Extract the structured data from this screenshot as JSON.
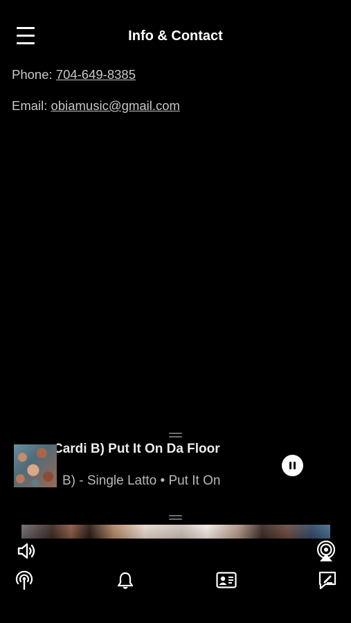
{
  "header": {
    "title": "Info & Contact",
    "menu_icon": "hamburger-menu-icon"
  },
  "contact": {
    "phone_label": "Phone:",
    "phone_value": "704-649-8385",
    "email_label": "Email:",
    "email_value": "obiamusic@gmail.com"
  },
  "now_playing": {
    "title_marquee": "Cardi B) Put It On Da Floor",
    "subtitle_marquee": "B) - Single Latto • Put It On",
    "state": "playing",
    "pause_icon": "pause-icon"
  },
  "video_controls": {
    "volume_icon": "speaker-volume-icon",
    "airplay_icon": "airplay-icon"
  },
  "tab_bar": {
    "items": [
      {
        "icon": "podcast-broadcast-icon"
      },
      {
        "icon": "bell-icon"
      },
      {
        "icon": "contact-card-icon"
      },
      {
        "icon": "compose-message-icon"
      }
    ]
  },
  "colors": {
    "background": "#000000",
    "text_primary": "#FFFFFF",
    "text_secondary": "#C8C8C8"
  }
}
